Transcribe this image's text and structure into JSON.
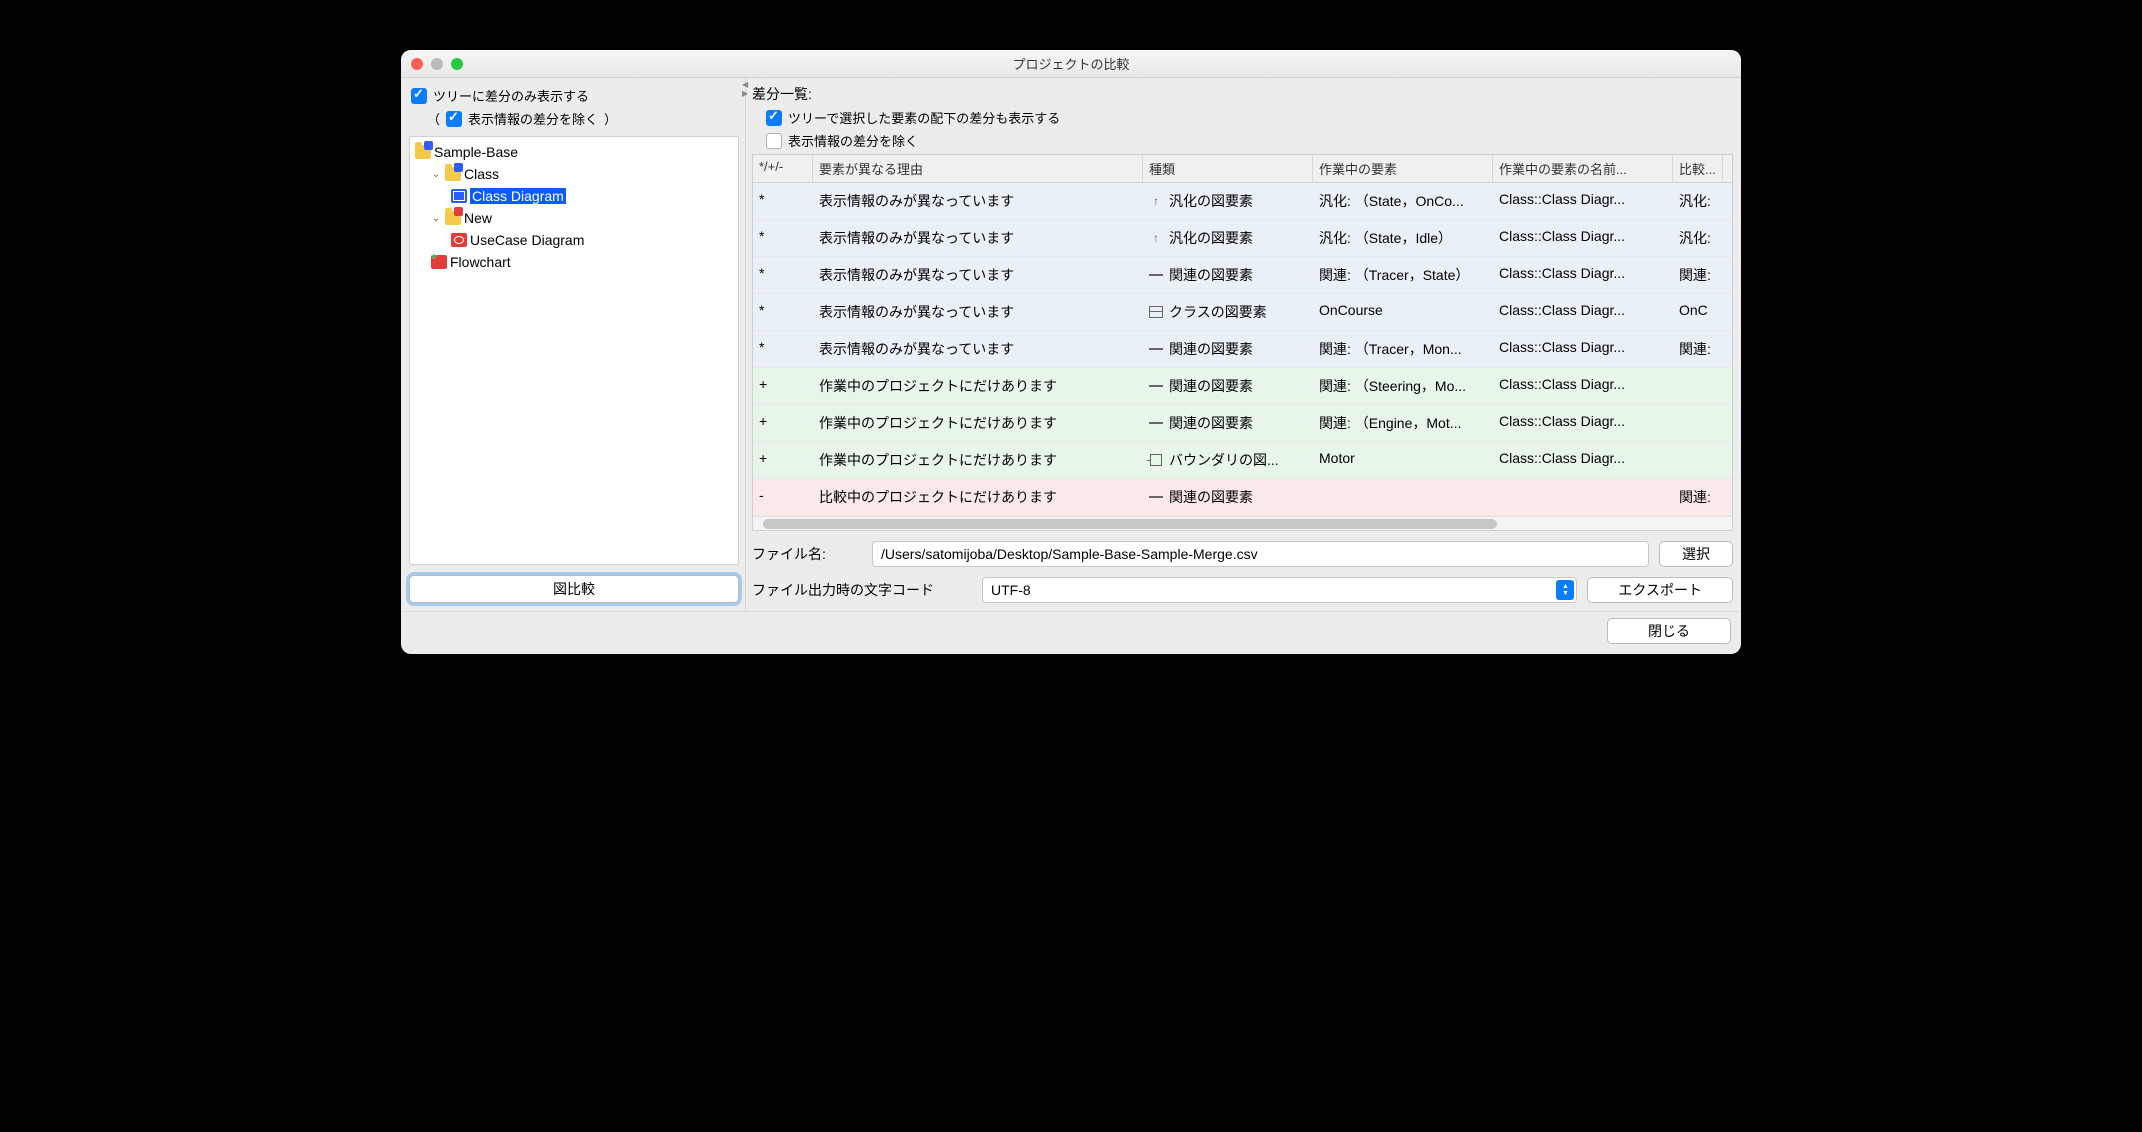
{
  "window": {
    "title": "プロジェクトの比較"
  },
  "left": {
    "diffOnlyLabel": "ツリーに差分のみ表示する",
    "excludeDispParenOpen": "（",
    "excludeDispLabel": "表示情報の差分を除く",
    "excludeDispParenClose": "）",
    "diagramCompareBtn": "図比較",
    "tree": {
      "root": "Sample-Base",
      "classFolder": "Class",
      "classDiagram": "Class Diagram",
      "newFolder": "New",
      "usecaseDiagram": "UseCase Diagram",
      "flowchart": "Flowchart"
    }
  },
  "right": {
    "headerLabel": "差分一覧:",
    "showSubLabel": "ツリーで選択した要素の配下の差分も表示する",
    "excludeDispLabel": "表示情報の差分を除く",
    "columns": {
      "mark": "*/+/-",
      "reason": "要素が異なる理由",
      "kind": "種類",
      "working": "作業中の要素",
      "workingName": "作業中の要素の名前...",
      "compare": "比較..."
    },
    "rows": [
      {
        "m": "*",
        "cls": "star",
        "reason": "表示情報のみが異なっています",
        "kindIcon": "gen",
        "kind": "汎化の図要素",
        "work": "汎化: （State，OnCo...",
        "name": "Class::Class Diagr...",
        "cmp": "汎化:"
      },
      {
        "m": "*",
        "cls": "star",
        "reason": "表示情報のみが異なっています",
        "kindIcon": "gen",
        "kind": "汎化の図要素",
        "work": "汎化: （State，Idle）",
        "name": "Class::Class Diagr...",
        "cmp": "汎化:"
      },
      {
        "m": "*",
        "cls": "star",
        "reason": "表示情報のみが異なっています",
        "kindIcon": "assoc",
        "kind": "関連の図要素",
        "work": "関連: （Tracer，State）",
        "name": "Class::Class Diagr...",
        "cmp": "関連:"
      },
      {
        "m": "*",
        "cls": "star",
        "reason": "表示情報のみが異なっています",
        "kindIcon": "class",
        "kind": "クラスの図要素",
        "work": "OnCourse",
        "name": "Class::Class Diagr...",
        "cmp": "OnC"
      },
      {
        "m": "*",
        "cls": "star",
        "reason": "表示情報のみが異なっています",
        "kindIcon": "assoc",
        "kind": "関連の図要素",
        "work": "関連: （Tracer，Mon...",
        "name": "Class::Class Diagr...",
        "cmp": "関連:"
      },
      {
        "m": "+",
        "cls": "plus",
        "reason": "作業中のプロジェクトにだけあります",
        "kindIcon": "assoc",
        "kind": "関連の図要素",
        "work": "関連: （Steering，Mo...",
        "name": "Class::Class Diagr...",
        "cmp": ""
      },
      {
        "m": "+",
        "cls": "plus",
        "reason": "作業中のプロジェクトにだけあります",
        "kindIcon": "assoc",
        "kind": "関連の図要素",
        "work": "関連: （Engine，Mot...",
        "name": "Class::Class Diagr...",
        "cmp": ""
      },
      {
        "m": "+",
        "cls": "plus",
        "reason": "作業中のプロジェクトにだけあります",
        "kindIcon": "bound",
        "kind": "バウンダリの図...",
        "work": "Motor",
        "name": "Class::Class Diagr...",
        "cmp": ""
      },
      {
        "m": "-",
        "cls": "minus",
        "reason": "比較中のプロジェクトにだけあります",
        "kindIcon": "assoc",
        "kind": "関連の図要素",
        "work": "",
        "name": "",
        "cmp": "関連:"
      }
    ],
    "fileLabel": "ファイル名:",
    "filePath": "/Users/satomijoba/Desktop/Sample-Base-Sample-Merge.csv",
    "chooseBtn": "選択",
    "encodingLabel": "ファイル出力時の文字コード",
    "encodingValue": "UTF-8",
    "exportBtn": "エクスポート"
  },
  "footer": {
    "closeBtn": "閉じる"
  }
}
